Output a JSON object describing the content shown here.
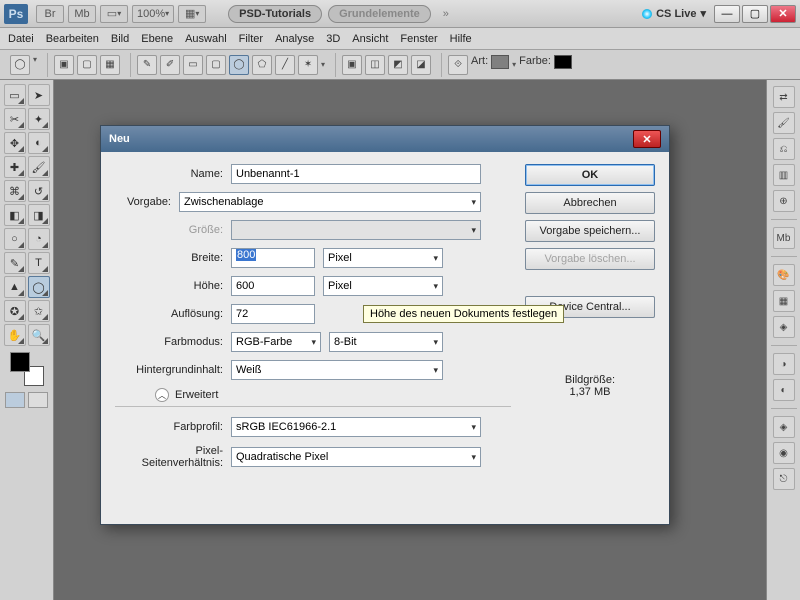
{
  "titlebar": {
    "zoom": "100%",
    "tab1": "PSD-Tutorials",
    "tab2": "Grundelemente",
    "more": "»",
    "cslive": "CS Live"
  },
  "menu": [
    "Datei",
    "Bearbeiten",
    "Bild",
    "Ebene",
    "Auswahl",
    "Filter",
    "Analyse",
    "3D",
    "Ansicht",
    "Fenster",
    "Hilfe"
  ],
  "optbar": {
    "art": "Art:",
    "farbe": "Farbe:"
  },
  "dialog": {
    "title": "Neu",
    "name_lbl": "Name:",
    "name_val": "Unbenannt-1",
    "preset_lbl": "Vorgabe:",
    "preset_val": "Zwischenablage",
    "size_lbl": "Größe:",
    "width_lbl": "Breite:",
    "width_val": "800",
    "width_unit": "Pixel",
    "height_lbl": "Höhe:",
    "height_val": "600",
    "height_unit": "Pixel",
    "res_lbl": "Auflösung:",
    "res_val": "72",
    "colormode_lbl": "Farbmodus:",
    "colormode_val": "RGB-Farbe",
    "bit_val": "8-Bit",
    "bgcontent_lbl": "Hintergrundinhalt:",
    "bgcontent_val": "Weiß",
    "advanced": "Erweitert",
    "profile_lbl": "Farbprofil:",
    "profile_val": "sRGB IEC61966-2.1",
    "par_lbl": "Pixel-Seitenverhältnis:",
    "par_val": "Quadratische Pixel",
    "ok": "OK",
    "cancel": "Abbrechen",
    "save_preset": "Vorgabe speichern...",
    "del_preset": "Vorgabe löschen...",
    "device_central": "Device Central...",
    "filesize_lbl": "Bildgröße:",
    "filesize_val": "1,37 MB"
  },
  "tooltip": "Höhe des neuen Dokuments festlegen"
}
